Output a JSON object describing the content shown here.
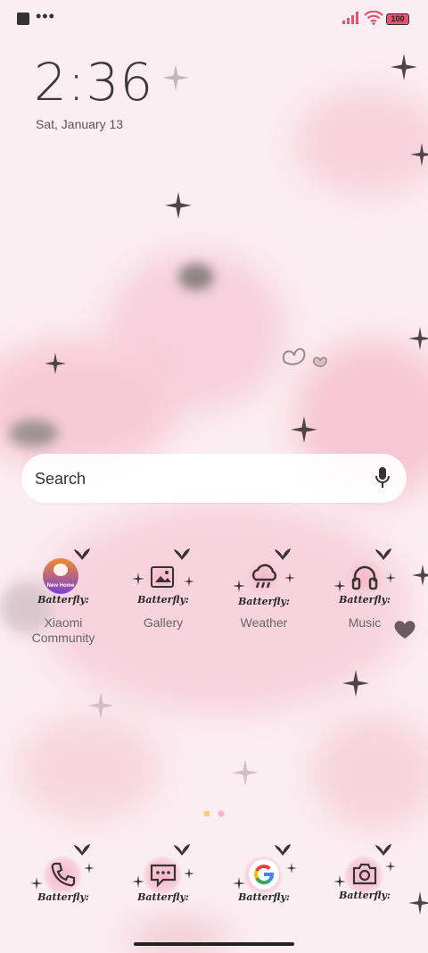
{
  "status_bar": {
    "battery": "100",
    "icons": [
      "app-square-icon",
      "more-dots-icon",
      "signal-icon",
      "wifi-icon",
      "battery-icon"
    ],
    "more_label": "•••"
  },
  "lock": {
    "time": "2:36",
    "date": "Sat, January 13"
  },
  "search": {
    "placeholder": "Search",
    "icon": "mic-icon"
  },
  "apps_row1": [
    {
      "label": "Xiaomi Community",
      "badge": "New Home",
      "icon": "xiaomi-community-icon"
    },
    {
      "label": "Gallery",
      "icon": "gallery-icon"
    },
    {
      "label": "Weather",
      "icon": "weather-icon"
    },
    {
      "label": "Music",
      "icon": "music-icon"
    }
  ],
  "dock": [
    {
      "icon": "phone-icon"
    },
    {
      "icon": "messages-icon"
    },
    {
      "icon": "google-icon"
    },
    {
      "icon": "camera-icon"
    }
  ],
  "theme_caption": "Batterfly:",
  "colors": {
    "background": "#fbeef2",
    "pink": "#f4bfcf",
    "dark": "#3a3a3a"
  }
}
